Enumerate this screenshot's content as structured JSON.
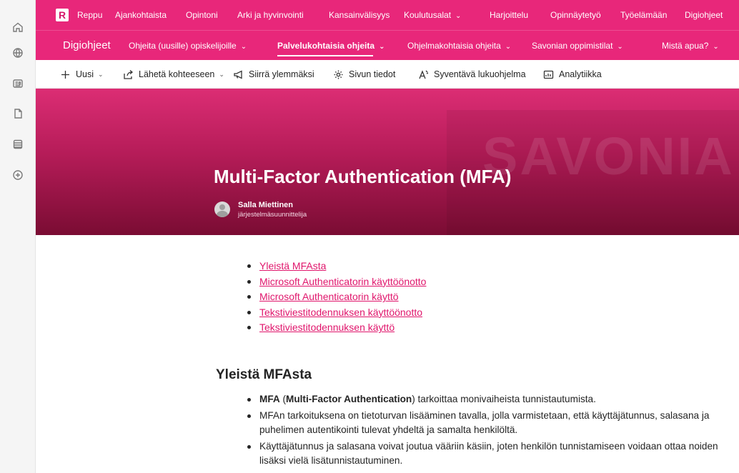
{
  "rail": {
    "icons": [
      "home-icon",
      "globe-icon",
      "news-icon",
      "document-icon",
      "list-icon",
      "add-circle-icon"
    ]
  },
  "topnav": {
    "logo_letter": "R",
    "items": [
      "Reppu",
      "Ajankohtaista",
      "Opintoni",
      "Arki ja hyvinvointi",
      "Kansainvälisyys",
      "Koulutusalat",
      "Harjoittelu",
      "Opinnäytetyö",
      "Työelämään",
      "Digiohjeet"
    ]
  },
  "subnav": {
    "site_title": "Digiohjeet",
    "items": [
      "Ohjeita (uusille) opiskelijoille",
      "Palvelukohtaisia ohjeita",
      "Ohjelmakohtaisia ohjeita",
      "Savonian oppimistilat",
      "Mistä apua?"
    ]
  },
  "commandbar": {
    "new": "Uusi",
    "send": "Lähetä kohteeseen",
    "move_up": "Siirrä ylemmäksi",
    "page_details": "Sivun tiedot",
    "immersive_reader": "Syventävä lukuohjelma",
    "analytics": "Analytiikka"
  },
  "hero": {
    "brand_watermark": "SAVONIA",
    "title": "Multi-Factor Authentication (MFA)",
    "author_name": "Salla Miettinen",
    "author_role": "järjestelmäsuunnittelija"
  },
  "toc": [
    "Yleistä MFAsta",
    "Microsoft Authenticatorin käyttöönotto",
    "Microsoft Authenticatorin käyttö",
    "Tekstiviestitodennuksen käyttöönotto",
    "Tekstiviestitodennuksen käyttö"
  ],
  "section": {
    "title": "Yleistä MFAsta",
    "b1_strong1": "MFA",
    "b1_open": " (",
    "b1_strong2": "Multi-Factor Authentication",
    "b1_rest": ") tarkoittaa monivaiheista tunnistautumista.",
    "b2": "MFAn tarkoituksena on tietoturvan lisääminen tavalla, jolla varmistetaan, että käyttäjätunnus, salasana ja puhelimen autentikointi tulevat yhdeltä ja samalta henkilöltä.",
    "b3": "Käyttäjätunnus ja salasana voivat joutua vääriin käsiin, joten henkilön tunnistamiseen voidaan ottaa noiden lisäksi vielä lisätunnistautuminen."
  },
  "colors": {
    "accent": "#e8277a",
    "link": "#e0166c",
    "hero_dark": "#7a0c33"
  }
}
